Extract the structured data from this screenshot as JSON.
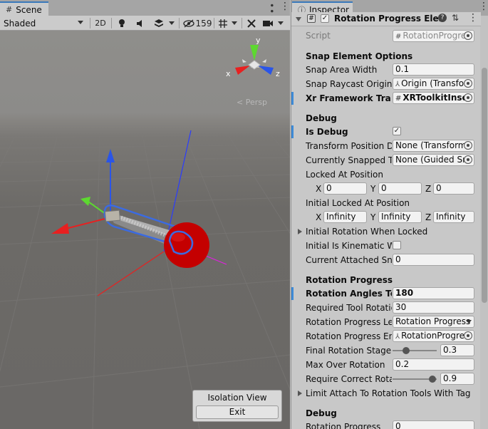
{
  "scene": {
    "tab_label": "Scene",
    "shading_mode": "Shaded",
    "mode_2d": "2D",
    "hidden_count": "159",
    "gizmo_view_label": "< Persp",
    "axis_labels": {
      "x": "x",
      "y": "y",
      "z": "z"
    },
    "isolation": {
      "title": "Isolation View",
      "exit_label": "Exit"
    }
  },
  "inspector": {
    "tab_label": "Inspector",
    "component_title": "Rotation Progress Elem",
    "component_enabled": true,
    "script": {
      "label": "Script",
      "value": "RotationProgre"
    },
    "sections": {
      "snap": {
        "header": "Snap Element Options",
        "snap_area_width": {
          "label": "Snap Area Width",
          "value": "0.1"
        },
        "snap_raycast_origin": {
          "label": "Snap Raycast Origin",
          "value": "Origin (Transfo"
        },
        "xr_framework_trans": {
          "label": "Xr Framework Trans",
          "value": "XRToolkitInser"
        }
      },
      "debug": {
        "header": "Debug",
        "is_debug": {
          "label": "Is Debug",
          "checked": true
        },
        "transform_position": {
          "label": "Transform Position Dr",
          "value": "None (Transform"
        },
        "currently_snapped": {
          "label": "Currently Snapped To",
          "value": "None (Guided Sn"
        },
        "locked_at_position": {
          "label": "Locked At Position",
          "x": "0",
          "y": "0",
          "z": "0"
        },
        "initial_locked_at_position": {
          "label": "Initial Locked At Position",
          "x": "Infinity",
          "y": "Infinity",
          "z": "Infinity"
        },
        "initial_rotation_when_locked": {
          "label": "Initial Rotation When Locked"
        },
        "initial_is_kinematic": {
          "label": "Initial Is Kinematic Wh",
          "checked": false
        },
        "current_attached_snap": {
          "label": "Current Attached Sna",
          "value": "0"
        }
      },
      "rotation": {
        "header": "Rotation Progress",
        "rotation_angles": {
          "label": "Rotation Angles To F",
          "value": "180"
        },
        "required_tool_rotation": {
          "label": "Required Tool Rotatio",
          "value": "30"
        },
        "rotation_progress_len": {
          "label": "Rotation Progress Len",
          "value": "Rotation Progress"
        },
        "rotation_progress_end": {
          "label": "Rotation Progress End",
          "value": "RotationProgre"
        },
        "final_rotation_stage": {
          "label": "Final Rotation Stage D",
          "value": "0.3",
          "fraction": 0.3
        },
        "max_over_rotation": {
          "label": "Max Over Rotation",
          "value": "0.2"
        },
        "require_correct_rotat": {
          "label": "Require Correct Rotat",
          "value": "0.9",
          "fraction": 0.9
        },
        "limit_attach": {
          "label": "Limit Attach To Rotation Tools With Tag"
        }
      },
      "debug2": {
        "header": "Debug",
        "rotation_progress": {
          "label": "Rotation Progress",
          "value": "0"
        }
      }
    }
  },
  "colors": {
    "accent": "#3a79bb",
    "axis_x": "#e02020",
    "axis_y": "#2eb82e",
    "axis_z": "#2060e0",
    "ball": "#c40000"
  }
}
